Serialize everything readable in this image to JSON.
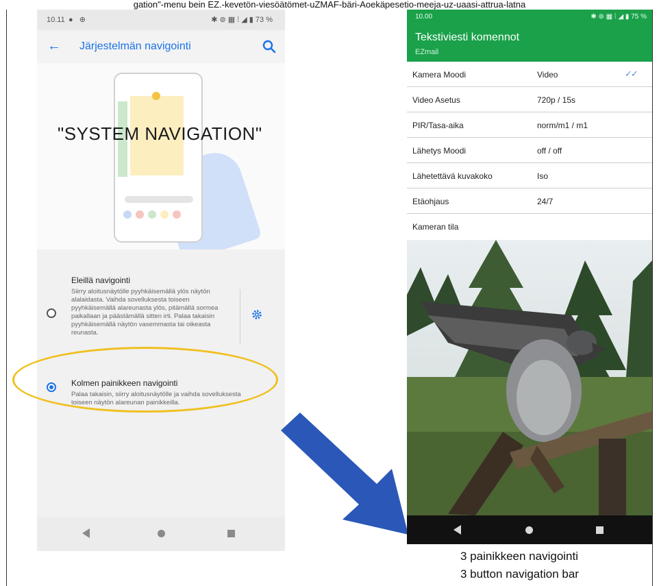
{
  "caption": {
    "top": "gation\"-menu bein EZ.-kevetön-viesöätömet-uZMAF-bäri-Aoekäpesetio-meeja-uz-uaasi-attrua-latna",
    "bottom_line1": "3 painikkeen navigointi",
    "bottom_line2": "3 button navigation bar"
  },
  "left_phone": {
    "status": {
      "time": "10.11",
      "left_icons": "● ⊕",
      "right_icons": "✱ ⊚ ▦ ⁞ ◢ ▮ 73 %"
    },
    "appbar": {
      "title": "Järjestelmän navigointi",
      "back_icon": "arrow-left-icon",
      "search_icon": "search-icon"
    },
    "overlay": "\"SYSTEM NAVIGATION\"",
    "options": [
      {
        "title": "Eleillä navigointi",
        "description": "Siirry aloitusnäytölle pyyhkäisemällä ylös näytön alalaidasta. Vaihda sovelluksesta toiseen pyyhkäisemällä alareunasta ylös, pitämällä sormea paikallaan ja päästämällä sitten irti. Palaa takaisin pyyhkäisemällä näytön vasemmasta tai oikeasta reunasta.",
        "selected": false,
        "settings_icon": "gear-icon"
      },
      {
        "title": "Kolmen painikkeen navigointi",
        "description": "Palaa takaisin, siirry aloitusnäytölle ja vaihda sovelluksesta toiseen näytön alareunan painikkeilla.",
        "selected": true
      }
    ],
    "highlight_color": "#f0c020"
  },
  "right_phone": {
    "status": {
      "time": "10.00",
      "right_icons": "✱ ⊚ ▦ ⁞ ◢ ▮ 75 %"
    },
    "appbar": {
      "title": "Tekstiviesti komennot",
      "subtitle": "EZmail",
      "color": "#1aa14a"
    },
    "rows": [
      {
        "key": "Kamera Moodi",
        "value": "Video",
        "tick": "✓✓"
      },
      {
        "key": "Video Asetus",
        "value": "720p / 15s"
      },
      {
        "key": "PIR/Tasa-aika",
        "value": "norm/m1 / m1"
      },
      {
        "key": "Lähetys Moodi",
        "value": "off / off"
      },
      {
        "key": "Lähetettävä kuvakoko",
        "value": "Iso"
      },
      {
        "key": "Etäohjaus",
        "value": "24/7"
      },
      {
        "key": "Kameran tila",
        "value": ""
      }
    ]
  },
  "arrow_color": "#2a57b8"
}
